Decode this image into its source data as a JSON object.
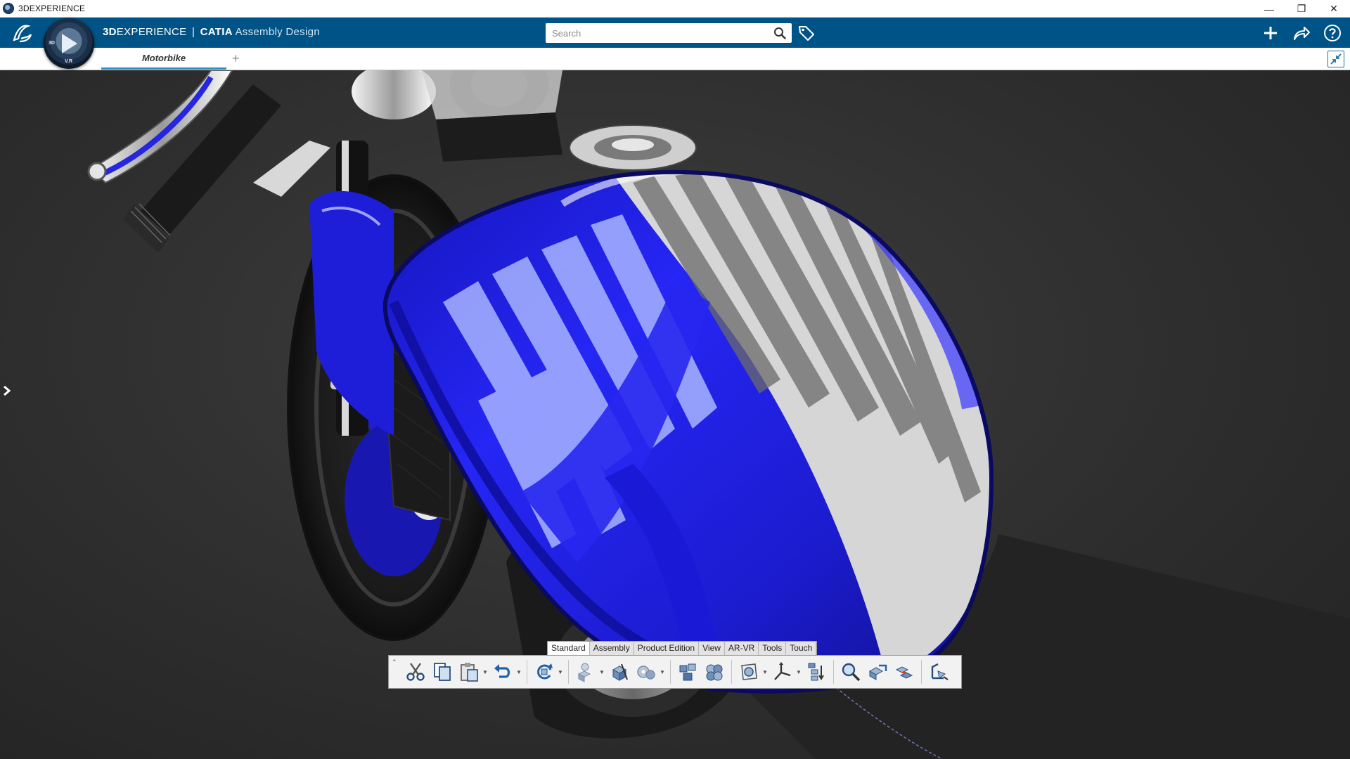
{
  "os_window": {
    "title": "3DEXPERIENCE",
    "controls": [
      "—",
      "❐",
      "✕"
    ]
  },
  "header": {
    "brand_prefix": "3D",
    "brand_main": "EXPERIENCE",
    "separator": "|",
    "product": "CATIA",
    "app_name": "Assembly Design",
    "compass_labels": [
      "3D",
      "V.R"
    ],
    "search_placeholder": "Search"
  },
  "tabs": {
    "items": [
      {
        "label": "Motorbike"
      }
    ],
    "add_label": "+"
  },
  "action_bar": {
    "sections": [
      "Standard",
      "Assembly",
      "Product Edition",
      "View",
      "AR-VR",
      "Tools",
      "Touch"
    ],
    "active_section": "Standard",
    "collapse_glyph": "⌃"
  },
  "colors": {
    "header_blue": "#005386",
    "tab_accent": "#368ec4",
    "tank_blue": "#1f1fe0",
    "viewport_bg": "#2e2e2e"
  }
}
